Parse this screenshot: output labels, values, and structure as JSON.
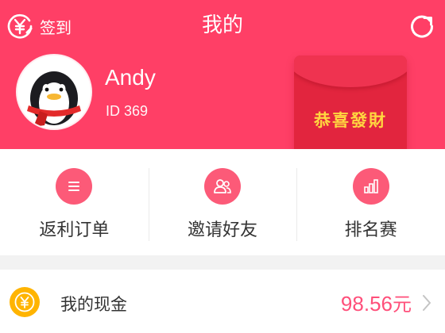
{
  "header": {
    "title": "我的",
    "checkin_label": "签到",
    "bg_color": "#ff3f66",
    "checkin_icon": "yen-sign-in-icon",
    "refresh_icon": "refresh-icon"
  },
  "profile": {
    "name": "Andy",
    "id_text": "ID 369",
    "avatar": "penguin-avatar"
  },
  "red_packet": {
    "text": "恭喜發財",
    "color": "#e2253e",
    "text_color": "#ffd640"
  },
  "actions": [
    {
      "label": "返利订单",
      "icon": "list-icon"
    },
    {
      "label": "邀请好友",
      "icon": "friends-icon"
    },
    {
      "label": "排名赛",
      "icon": "ranking-icon"
    }
  ],
  "cash": {
    "label": "我的现金",
    "amount": "98.56",
    "unit": "元",
    "icon": "yen-coin-icon",
    "amount_color": "#ff4f7a"
  }
}
